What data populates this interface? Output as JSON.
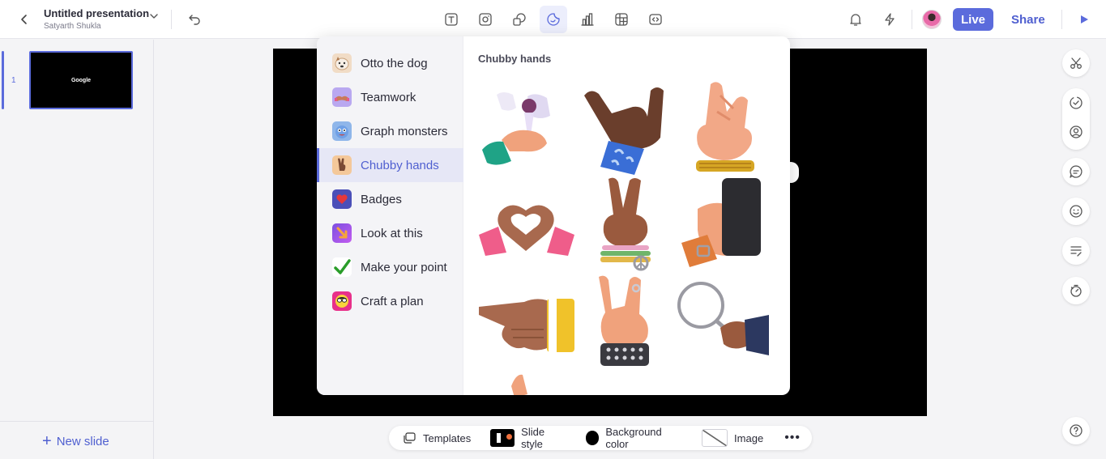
{
  "header": {
    "title": "Untitled presentation",
    "owner": "Satyarth Shukla",
    "live_label": "Live",
    "share_label": "Share"
  },
  "toolbar_icons": [
    "text-icon",
    "image-icon",
    "shapes-icon",
    "sticker-icon",
    "chart-icon",
    "table-icon",
    "embed-icon"
  ],
  "slides": [
    {
      "number": "1",
      "thumb_text": "Google"
    }
  ],
  "new_slide_label": "New slide",
  "bottom_bar": {
    "templates": "Templates",
    "slide_style": "Slide style",
    "background_color": "Background color",
    "image": "Image",
    "more": "•••"
  },
  "stickers": {
    "categories": [
      {
        "label": "Otto the dog",
        "icon": "dog-icon"
      },
      {
        "label": "Teamwork",
        "icon": "teamwork-icon"
      },
      {
        "label": "Graph monsters",
        "icon": "monster-icon"
      },
      {
        "label": "Chubby hands",
        "icon": "hand-icon",
        "active": true
      },
      {
        "label": "Badges",
        "icon": "heart-badge-icon"
      },
      {
        "label": "Look at this",
        "icon": "arrow-icon"
      },
      {
        "label": "Make your point",
        "icon": "checkmark-icon"
      },
      {
        "label": "Craft a plan",
        "icon": "face-icon"
      }
    ],
    "grid_title": "Chubby hands",
    "items": [
      "hand-holding-glass",
      "hand-shaka",
      "hand-fingers-crossed",
      "hands-heart",
      "hand-peace-sign",
      "hand-holding-phone",
      "hand-pointing",
      "hand-rock-sign",
      "hand-magnifier",
      "hand-partial"
    ]
  },
  "colors": {
    "accent": "#5b6bdc",
    "canvas": "#000000"
  }
}
